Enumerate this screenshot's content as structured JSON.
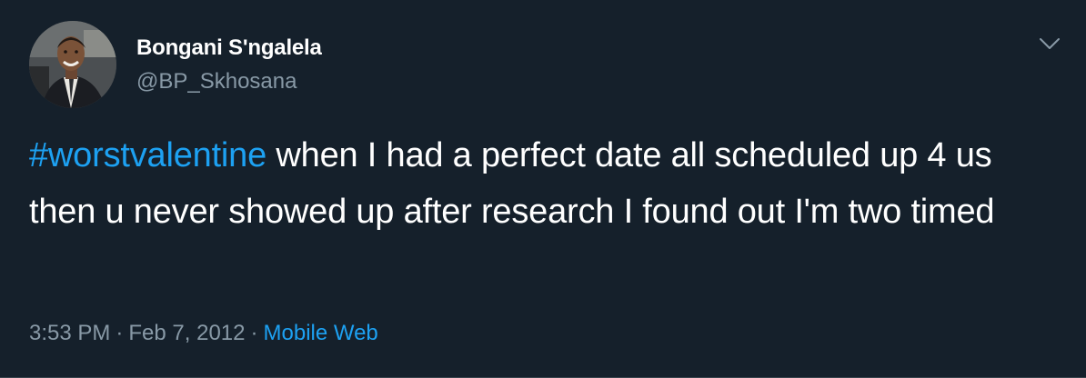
{
  "colors": {
    "background": "#15202b",
    "primary_text": "#ffffff",
    "secondary_text": "#8899a6",
    "accent": "#1da1f2"
  },
  "tweet": {
    "author": {
      "display_name": "Bongani S'ngalela",
      "handle": "@BP_Skhosana",
      "avatar_icon": "profile-photo"
    },
    "menu_icon": "chevron-down-icon",
    "text": {
      "hashtag": "#worstvalentine",
      "body": " when I had a perfect date all scheduled up 4 us then u never showed up after research I found out I'm two timed"
    },
    "meta": {
      "time": "3:53 PM",
      "separator": "·",
      "date": "Feb 7, 2012",
      "source": "Mobile Web"
    }
  }
}
